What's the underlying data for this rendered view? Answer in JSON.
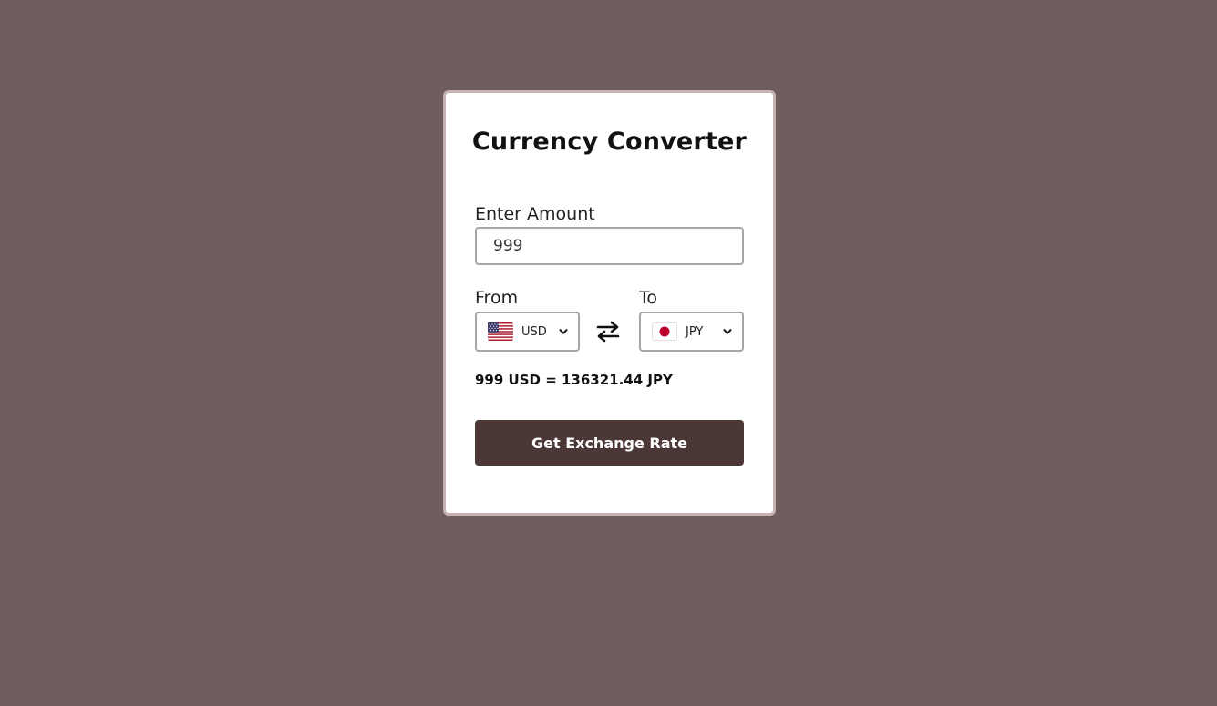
{
  "page": {
    "background": "#6d5e5d"
  },
  "card": {
    "title": "Currency Converter"
  },
  "amount": {
    "label": "Enter Amount",
    "value": "999"
  },
  "from": {
    "label": "From",
    "currency": "USD",
    "flag": "us-flag-icon"
  },
  "to": {
    "label": "To",
    "currency": "JPY",
    "flag": "japan-flag-icon"
  },
  "result": {
    "text": "999 USD = 136321.44 JPY"
  },
  "button": {
    "label": "Get Exchange Rate",
    "color": "#4a3736"
  }
}
